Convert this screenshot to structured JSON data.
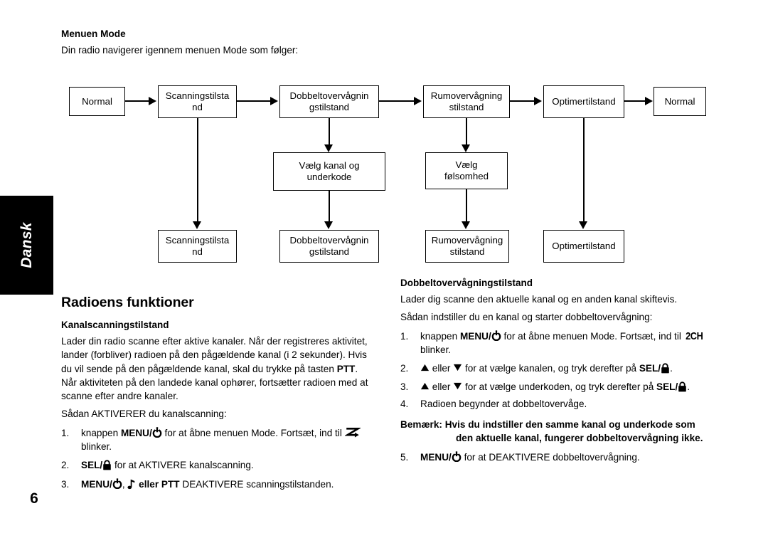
{
  "page": {
    "number": "6",
    "language_tab": "Dansk"
  },
  "menu_mode": {
    "title": "Menuen Mode",
    "intro": "Din radio navigerer igennem menuen Mode som følger:"
  },
  "flowchart": {
    "top_row": [
      "Normal",
      "Scanningstilsta nd",
      "Dobbeltovervågnin gstilstand",
      "Rumovervågning stilstand",
      "Optimertilstand",
      "Normal"
    ],
    "middle_row": [
      "Vælg kanal og underkode",
      "Vælg følsomhed"
    ],
    "bottom_row": [
      "Scanningstilsta nd",
      "Dobbeltovervågnin gstilstand",
      "Rumovervågning stilstand",
      "Optimertilstand"
    ],
    "boxes": {
      "normal_1_line1": "Normal",
      "scan_top_line1": "Scanningstilsta",
      "scan_top_line2": "nd",
      "dual_top_line1": "Dobbeltovervågnin",
      "dual_top_line2": "gstilstand",
      "room_top_line1": "Rumovervågning",
      "room_top_line2": "stilstand",
      "timer_top_line1": "Optimertilstand",
      "normal_2_line1": "Normal",
      "pick_channel_line1": "Vælg kanal og",
      "pick_channel_line2": "underkode",
      "pick_sens_line1": "Vælg",
      "pick_sens_line2": "følsomhed",
      "scan_bot_line1": "Scanningstilsta",
      "scan_bot_line2": "nd",
      "dual_bot_line1": "Dobbeltovervågnin",
      "dual_bot_line2": "gstilstand",
      "room_bot_line1": "Rumovervågning",
      "room_bot_line2": "stilstand",
      "timer_bot_line1": "Optimertilstand"
    }
  },
  "left_column": {
    "section_title": "Radioens funktioner",
    "sub_title": "Kanalscanningstilstand",
    "para_1_a": "Lader din radio scanne efter aktive kanaler. Når der registreres aktivitet, lander (forbliver) radioen på den pågældende kanal (i 2 sekunder). Hvis du vil sende på den pågældende kanal, skal du trykke på tasten ",
    "para_1_ptt": "PTT",
    "para_1_b": ". Når aktiviteten på den landede kanal ophører, fortsætter radioen med at scanne efter andre kanaler.",
    "para_2": "Sådan AKTIVERER du kanalscanning:",
    "steps": [
      {
        "num": "1.",
        "a": "knappen ",
        "bold1": "MENU/",
        "icon1": "power-icon",
        "b": " for at åbne menuen Mode. Fortsæt, ind til ",
        "icon2": "scan-icon",
        "c": " blinker."
      },
      {
        "num": "2.",
        "bold1": "SEL/",
        "icon1": "lock-icon",
        "b": " for at AKTIVERE kanalscanning."
      },
      {
        "num": "3.",
        "bold1": "MENU/",
        "icon1": "power-icon",
        "b": ", ",
        "icon2": "music-note-icon",
        "bold2": " eller ",
        "bold3": "PTT",
        "c": " DEAKTIVERE scanningstilstanden."
      }
    ]
  },
  "right_column": {
    "sub_title": "Dobbeltovervågningstilstand",
    "para_1": "Lader dig scanne den aktuelle kanal og en anden kanal skiftevis.",
    "para_2": "Sådan indstiller du en kanal og starter dobbeltovervågning:",
    "steps": [
      {
        "num": "1.",
        "a": "knappen ",
        "bold1": "MENU/",
        "icon1": "power-icon",
        "b": " for at åbne menuen Mode. Fortsæt, ind til ",
        "icon2": "2ch-icon",
        "icon2_text": "2CH",
        "c": " blinker."
      },
      {
        "num": "2.",
        "icon_up": "triangle-up-icon",
        "a": " eller ",
        "icon_down": "triangle-down-icon",
        "b": " for at vælge kanalen, og tryk derefter på ",
        "bold1": "SEL/",
        "icon1": "lock-icon",
        "c": "."
      },
      {
        "num": "3.",
        "icon_up": "triangle-up-icon",
        "a": " eller ",
        "icon_down": "triangle-down-icon",
        "b": " for at vælge underkoden, og tryk derefter på ",
        "bold1": "SEL/",
        "icon1": "lock-icon",
        "c": "."
      },
      {
        "num": "4.",
        "a": "Radioen begynder at dobbeltovervåge."
      }
    ],
    "note_label": "Bemærk:",
    "note_text": " Hvis du indstiller den samme kanal og underkode som den aktuelle kanal, fungerer dobbeltovervågning ikke.",
    "step_5": {
      "num": "5.",
      "bold1": "MENU/",
      "icon1": "power-icon",
      "b": " for at DEAKTIVERE dobbeltovervågning."
    }
  },
  "colors": {
    "ink": "#000000",
    "paper": "#ffffff",
    "tab_background": "#000000",
    "tab_text": "#ffffff"
  }
}
